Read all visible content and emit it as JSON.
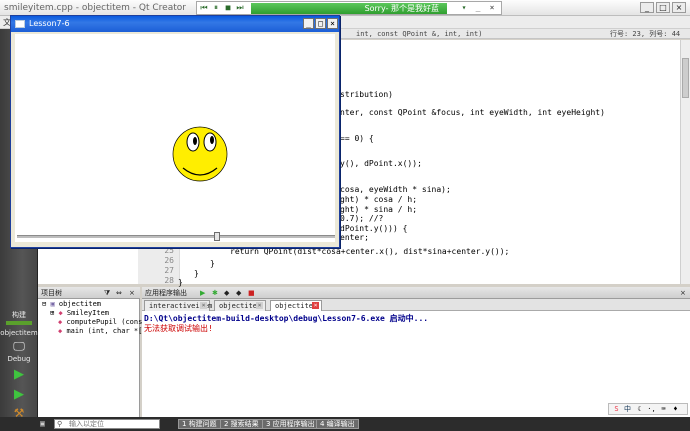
{
  "qtcreator": {
    "title": "smileyitem.cpp - objectitem - Qt Creator",
    "menu_first": "文",
    "editor_signature": "int, const QPoint &, int, int)",
    "position": "行号: 23, 列号: 44"
  },
  "player": {
    "song": "Sorry- 那个是我好蓝"
  },
  "lesson_window": {
    "title": "Lesson7-6",
    "slider_value": 0.63,
    "smiley": {
      "face_color": "#ffee00",
      "stroke_color": "#000000"
    }
  },
  "code": {
    "lines": [
      "stribution)",
      "nter, const QPoint &focus, int eyeWidth, int eyeHeight)",
      "== 0) {",
      "y(), dPoint.x());",
      "cosa, eyeWidth * sina);",
      "ght) * cosa / h;",
      "ght) * sina / h;",
      "0.7); //?",
      "dPoint.y())) {",
      "enter;",
      "return QPoint(dist*cosa+center.x(), dist*sina+center.y());",
      "}",
      "}",
      "}"
    ],
    "line_numbers": [
      "25",
      "26",
      "27",
      "28"
    ]
  },
  "modes": {
    "build_label": "构建",
    "project_label": "objectitem",
    "debug_label": "Debug"
  },
  "project_pane": {
    "header": "项目树",
    "items": [
      "objectitem",
      "SmileyItem",
      "computePupil (const QP",
      "main (int, char *[])"
    ]
  },
  "output_pane": {
    "header": "应用程序输出",
    "tabs": [
      "interactiveitem",
      "objectitem",
      "objectitem"
    ],
    "lines": [
      "D:\\Qt\\objectitem-build-desktop\\debug\\Lesson7-6.exe 启动中...",
      "无法获取调试输出!"
    ]
  },
  "statusbar": {
    "search_placeholder": "输入以定位",
    "buttons": [
      "1 构建问题",
      "2 搜索结果",
      "3 应用程序输出",
      "4 编译输出"
    ]
  },
  "colors": {
    "accent": "#0a5ade",
    "output_path": "#00008b",
    "output_error": "#cc0000",
    "player_green": "#2f9e2f"
  }
}
